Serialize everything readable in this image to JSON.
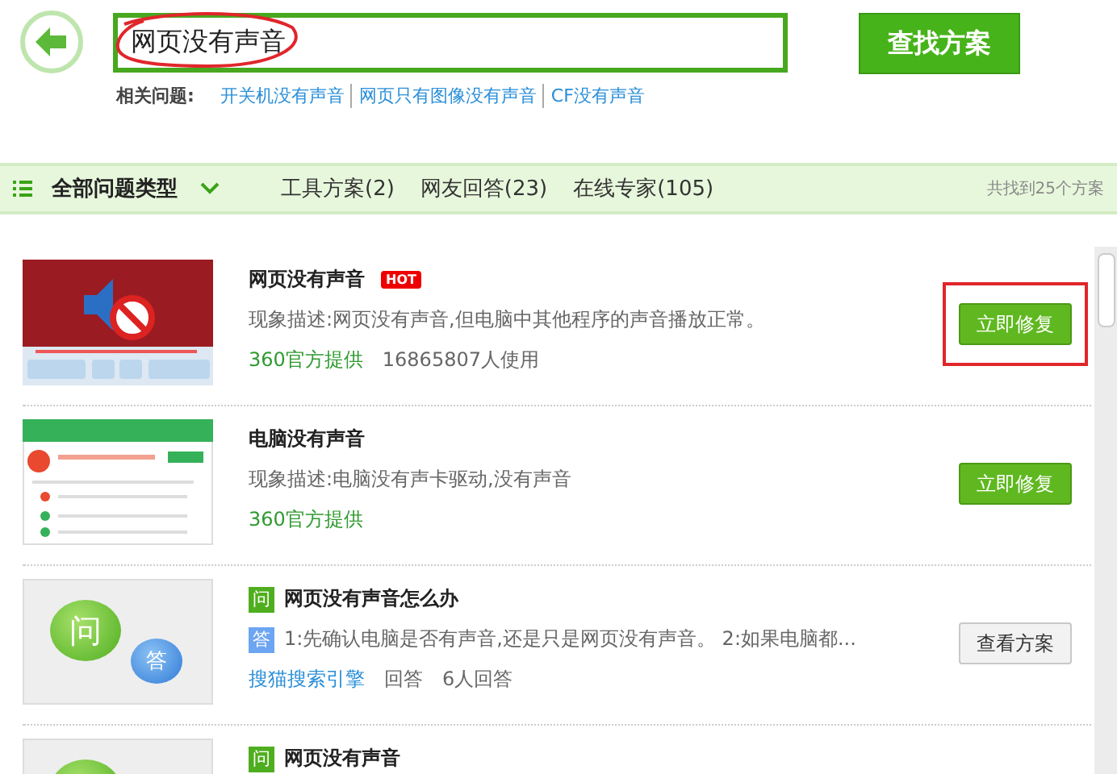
{
  "search": {
    "value": "网页没有声音",
    "button": "查找方案"
  },
  "related": {
    "label": "相关问题:",
    "links": [
      "开关机没有声音",
      "网页只有图像没有声音",
      "CF没有声音"
    ]
  },
  "filter_bar": {
    "category": "全部问题类型",
    "tabs": [
      {
        "label": "工具方案(2)",
        "selected": false
      },
      {
        "label": "网友回答(23)",
        "selected": false
      },
      {
        "label": "在线专家(105)",
        "selected": false
      }
    ],
    "count": "共找到25个方案"
  },
  "results": [
    {
      "kind": "video_tool",
      "title": "网页没有声音",
      "badge": "HOT",
      "desc": "现象描述:网页没有声音,但电脑中其他程序的声音播放正常。",
      "source": "360官方提供",
      "usage": "16865807人使用",
      "button": "立即修复",
      "highlighted": true
    },
    {
      "kind": "app_tool",
      "title": "电脑没有声音",
      "desc": "现象描述:电脑没有声卡驱动,没有声音",
      "source": "360官方提供",
      "button": "立即修复",
      "highlighted": false
    },
    {
      "kind": "qa",
      "bubble_q": "问",
      "bubble_a": "答",
      "q_mark": "问",
      "a_mark": "答",
      "title": "网页没有声音怎么办",
      "desc": "1:先确认电脑是否有声音,还是只是网页没有声音。 2:如果电脑都...",
      "source": "搜猫搜索引擎",
      "source_suffix": "回答",
      "answers": "6人回答",
      "button": "查看方案"
    },
    {
      "kind": "qa",
      "q_mark": "问",
      "title": "网页没有声音"
    }
  ]
}
